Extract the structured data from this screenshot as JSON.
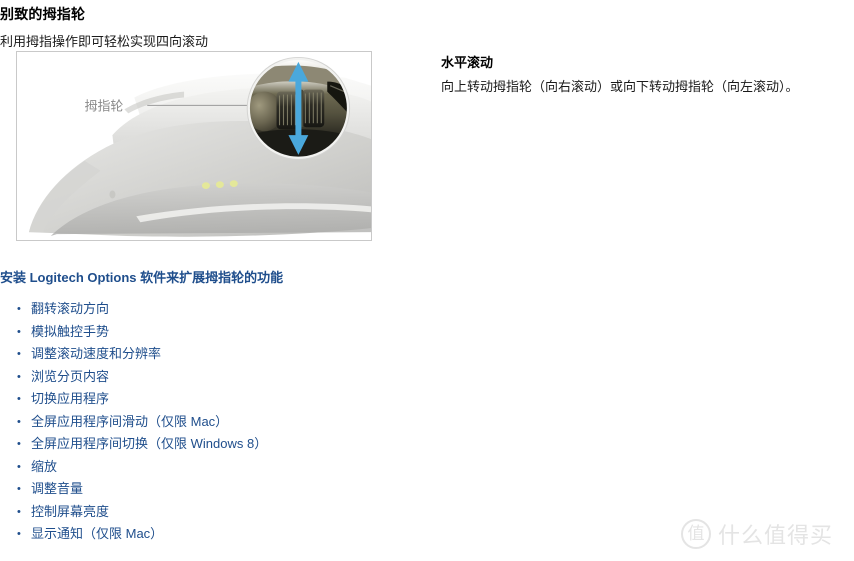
{
  "section": {
    "title": "别致的拇指轮",
    "subtitle": "利用拇指操作即可轻松实现四向滚动"
  },
  "illustration": {
    "callout_label": "拇指轮",
    "alt_name": "logitech-mx-master-thumbwheel-diagram",
    "magnifier": {
      "arrow_direction": "up-down",
      "arrow_color": "#4AA8DC"
    },
    "led_count": 3,
    "led_color": "#dde38a"
  },
  "options": {
    "heading": "安装 Logitech Options 软件来扩展拇指轮的功能",
    "bullet_glyph": "•",
    "features": [
      "翻转滚动方向",
      "模拟触控手势",
      "调整滚动速度和分辨率",
      "浏览分页内容",
      "切换应用程序",
      "全屏应用程序间滑动（仅限 Mac）",
      "全屏应用程序间切换（仅限 Windows 8）",
      "缩放",
      "调整音量",
      "控制屏幕亮度",
      "显示通知（仅限 Mac）"
    ]
  },
  "horizontal_scroll": {
    "heading": "水平滚动",
    "body": "向上转动拇指轮（向右滚动）或向下转动拇指轮（向左滚动）。"
  },
  "watermark": {
    "badge": "值",
    "text": "什么值得买"
  },
  "colors": {
    "accent_blue": "#1f4e8c",
    "arrow_blue": "#4AA8DC",
    "frame_border": "#c9c9c9",
    "watermark_gray": "#e4e4e4"
  }
}
